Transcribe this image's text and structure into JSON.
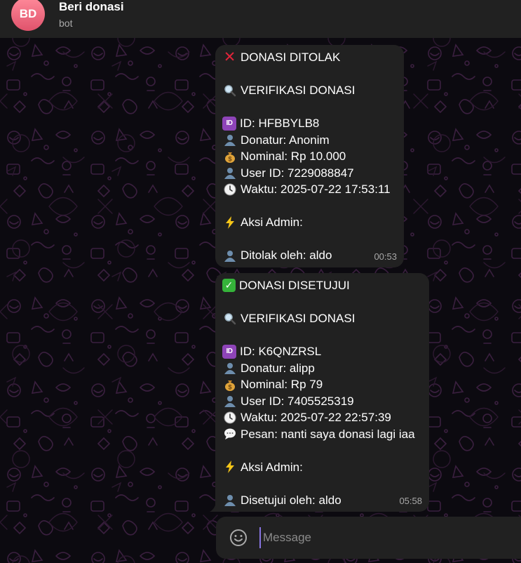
{
  "header": {
    "avatar_initials": "BD",
    "title": "Beri donasi",
    "subtitle": "bot"
  },
  "messages": [
    {
      "status_icon": "cross-mark",
      "status": "DONASI DITOLAK",
      "heading": "VERIFIKASI DONASI",
      "fields": [
        {
          "icon": "id-badge",
          "text": "ID: HFBBYLB8"
        },
        {
          "icon": "person",
          "text": "Donatur: Anonim"
        },
        {
          "icon": "money-bag",
          "text": "Nominal: Rp 10.000"
        },
        {
          "icon": "person",
          "text": "User ID: 7229088847"
        },
        {
          "icon": "clock",
          "text": "Waktu: 2025-07-22 17:53:11"
        }
      ],
      "action_label": "Aksi Admin:",
      "result": "Ditolak oleh: aldo",
      "time": "00:53"
    },
    {
      "status_icon": "check-mark",
      "status": "DONASI DISETUJUI",
      "heading": "VERIFIKASI DONASI",
      "fields": [
        {
          "icon": "id-badge",
          "text": "ID: K6QNZRSL"
        },
        {
          "icon": "person",
          "text": "Donatur: alipp"
        },
        {
          "icon": "money-bag",
          "text": "Nominal: Rp 79"
        },
        {
          "icon": "person",
          "text": "User ID: 7405525319"
        },
        {
          "icon": "clock",
          "text": "Waktu: 2025-07-22 22:57:39"
        },
        {
          "icon": "speech-bubble",
          "text": "Pesan: nanti saya donasi lagi iaa"
        }
      ],
      "action_label": "Aksi Admin:",
      "result": "Disetujui oleh: aldo",
      "time": "05:58"
    }
  ],
  "composer": {
    "placeholder": "Message"
  },
  "colors": {
    "header_bg": "#212121",
    "bubble_bg": "#212121",
    "accent": "#8774e1",
    "avatar_top": "#ff8a9a",
    "avatar_bottom": "#e0536c"
  }
}
